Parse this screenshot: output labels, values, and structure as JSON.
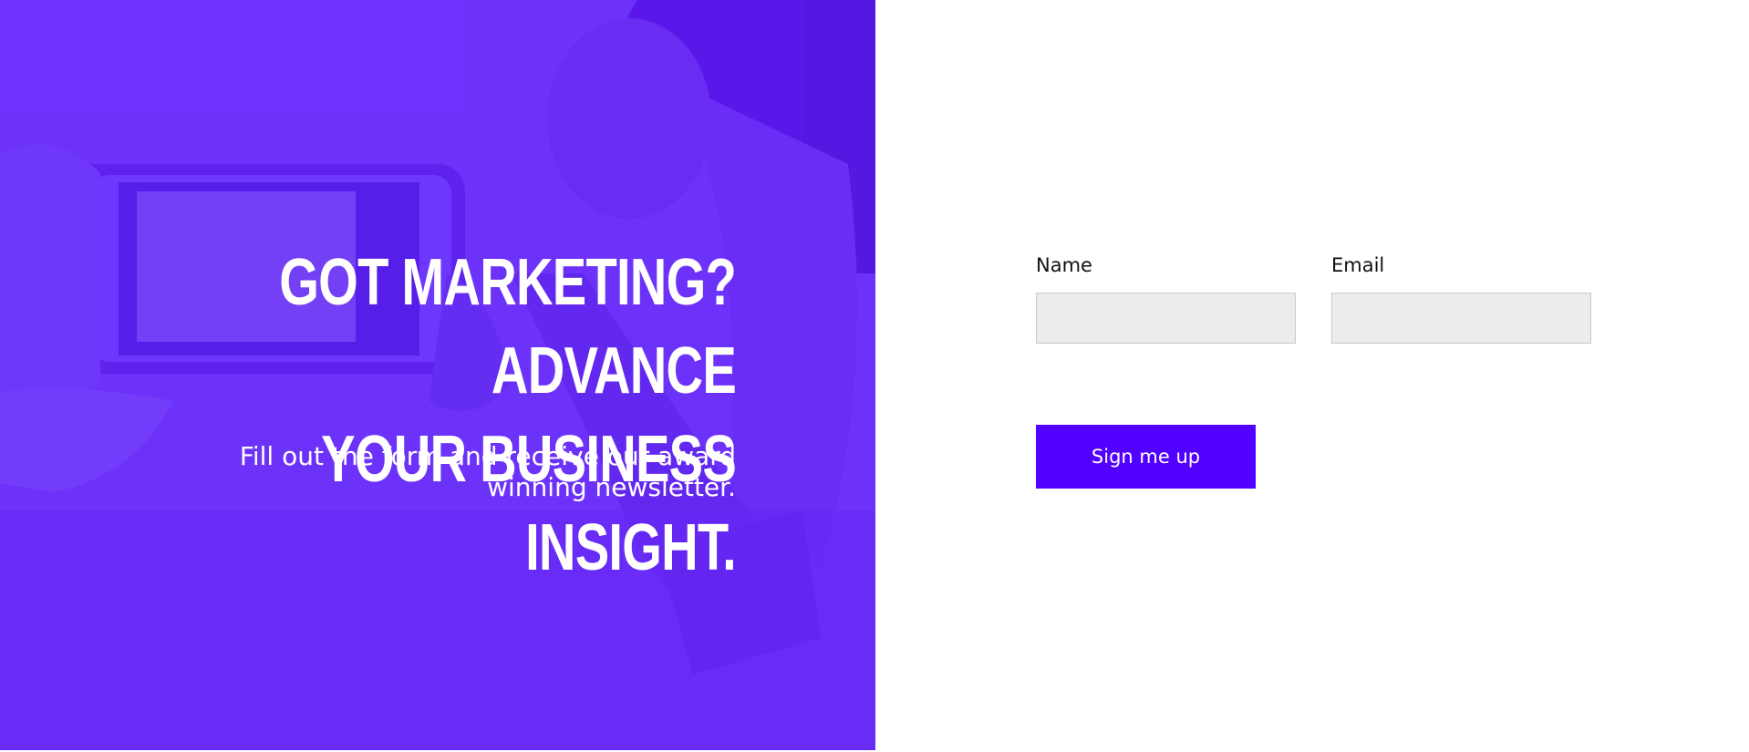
{
  "hero": {
    "title_line1": "GOT MARKETING? ADVANCE",
    "title_line2": "YOUR BUSINESS INSIGHT.",
    "subtitle_line1": "Fill out the form and receive our award",
    "subtitle_line2": "winning newsletter.",
    "background_image": "person-holding-phone-photo",
    "overlay_color": "#6d2df7"
  },
  "form": {
    "name_label": "Name",
    "name_value": "",
    "email_label": "Email",
    "email_value": "",
    "submit_label": "Sign me up",
    "submit_color": "#5200ff",
    "input_background": "#ececec"
  }
}
